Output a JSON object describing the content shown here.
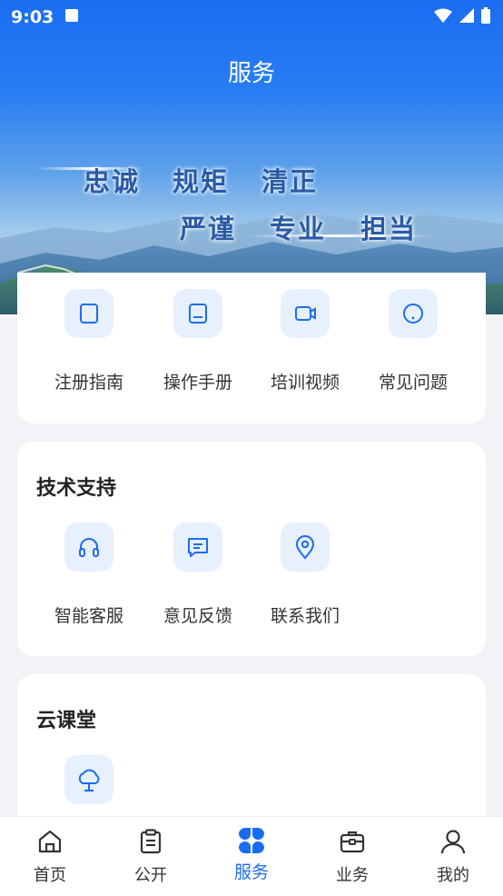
{
  "status": {
    "time": "9:03"
  },
  "header": {
    "title": "服务"
  },
  "banner": {
    "slogans": [
      "忠诚",
      "规矩",
      "清正",
      "严谨",
      "专业",
      "担当"
    ]
  },
  "card_guides": {
    "items": [
      {
        "label": "注册指南",
        "icon": "book-icon"
      },
      {
        "label": "操作手册",
        "icon": "document-icon"
      },
      {
        "label": "培训视频",
        "icon": "video-icon"
      },
      {
        "label": "常见问题",
        "icon": "question-icon"
      }
    ]
  },
  "card_support": {
    "title": "技术支持",
    "items": [
      {
        "label": "智能客服",
        "icon": "headset-icon"
      },
      {
        "label": "意见反馈",
        "icon": "feedback-icon"
      },
      {
        "label": "联系我们",
        "icon": "location-icon"
      }
    ]
  },
  "card_cloud": {
    "title": "云课堂",
    "items": [
      {
        "icon": "cloud-icon"
      }
    ]
  },
  "tabbar": {
    "active": "服务",
    "accent": "#1a6df2",
    "tabs": [
      {
        "label": "首页",
        "icon": "home-icon"
      },
      {
        "label": "公开",
        "icon": "clipboard-icon"
      },
      {
        "label": "服务",
        "icon": "grid-icon"
      },
      {
        "label": "业务",
        "icon": "briefcase-icon"
      },
      {
        "label": "我的",
        "icon": "user-icon"
      }
    ]
  }
}
